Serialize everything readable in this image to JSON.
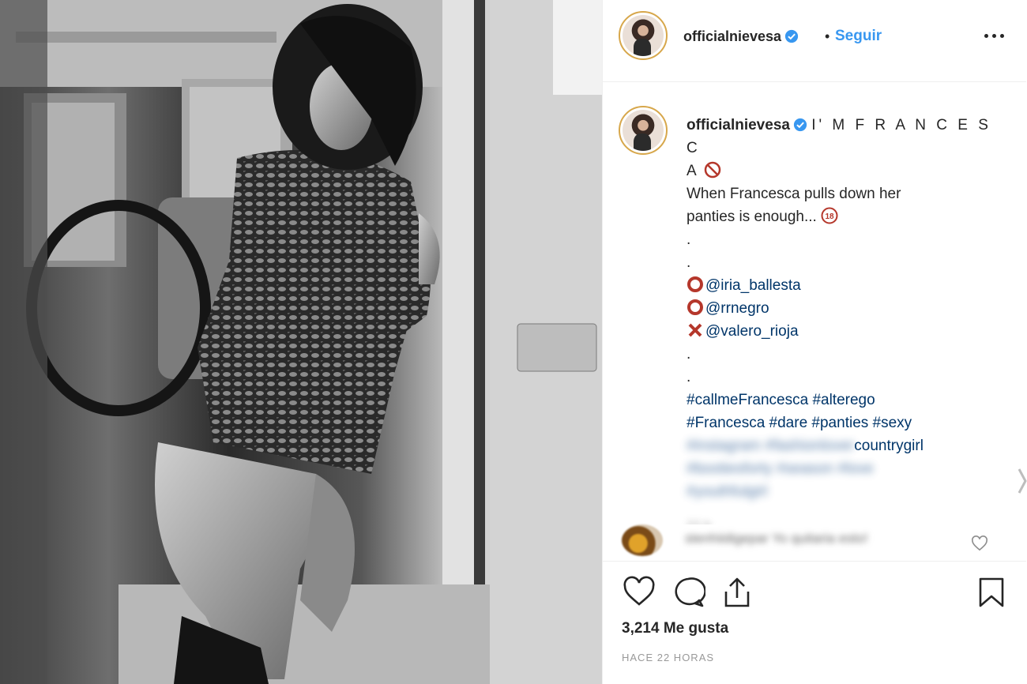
{
  "post": {
    "username": "officialnievesa",
    "separator": "•",
    "follow_label": "Seguir",
    "more_label": "more-options"
  },
  "caption": {
    "username": "officialnievesa",
    "title_line1": "I' M F R A N C E S C",
    "title_line2": "A",
    "body_line1": "When Francesca pulls down her",
    "body_line2": "panties is enough...",
    "dot1": ".",
    "dot2": ".",
    "mention1": "@iria_ballesta",
    "mention2": "@rrnegro",
    "mention3": "@valero_rioja",
    "dot3": ".",
    "dot4": ".",
    "hashtags_line1": "#callmeFrancesca #alterego",
    "hashtags_line2": "#Francesca #dare #panties #sexy",
    "hashtags_line3_blurred": "#instagram #fashionlover",
    "hashtags_line3_visible": "countrygirl",
    "hashtags_line4_blurred": "#bootiesforty #season #love",
    "hashtags_line5_blurred": "#youthfulgirl",
    "time_blurred": "22 h"
  },
  "comment": {
    "text_blurred": "stenhiidigepar Yo quitaria esto!"
  },
  "footer": {
    "likes": "3,214 Me gusta",
    "time": "HACE 22 HORAS"
  },
  "icons": {
    "verified": "verified-badge-icon",
    "prohibited": "no-entry-icon",
    "eighteen": "eighteen-plus-icon",
    "heavy_circle": "red-ring-icon",
    "cross": "red-cross-icon"
  },
  "colors": {
    "link": "#3897f0",
    "mention": "#003569",
    "text": "#262626",
    "muted": "#999999",
    "ring_red": "#b5372b",
    "avatar_ring": "#d7a74b"
  }
}
